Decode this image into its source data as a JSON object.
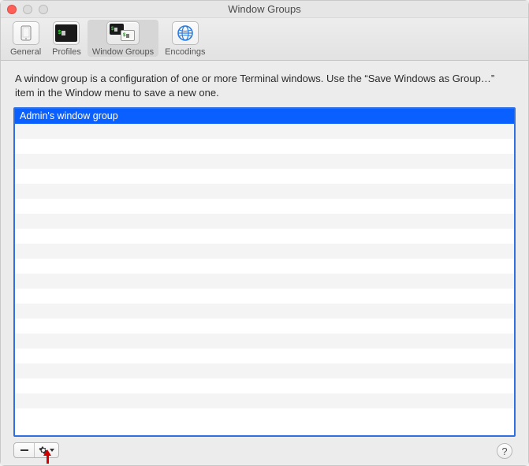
{
  "window": {
    "title": "Window Groups"
  },
  "toolbar": {
    "items": [
      {
        "label": "General"
      },
      {
        "label": "Profiles"
      },
      {
        "label": "Window Groups"
      },
      {
        "label": "Encodings"
      }
    ]
  },
  "description": "A window group is a configuration of one or more Terminal windows. Use the “Save Windows as Group…” item in the Window menu to save a new one.",
  "list": {
    "rows": [
      "Admin's window group"
    ],
    "total_visible_rows": 21
  },
  "footer": {
    "remove_tooltip": "Remove",
    "action_tooltip": "Action",
    "help": "?"
  }
}
